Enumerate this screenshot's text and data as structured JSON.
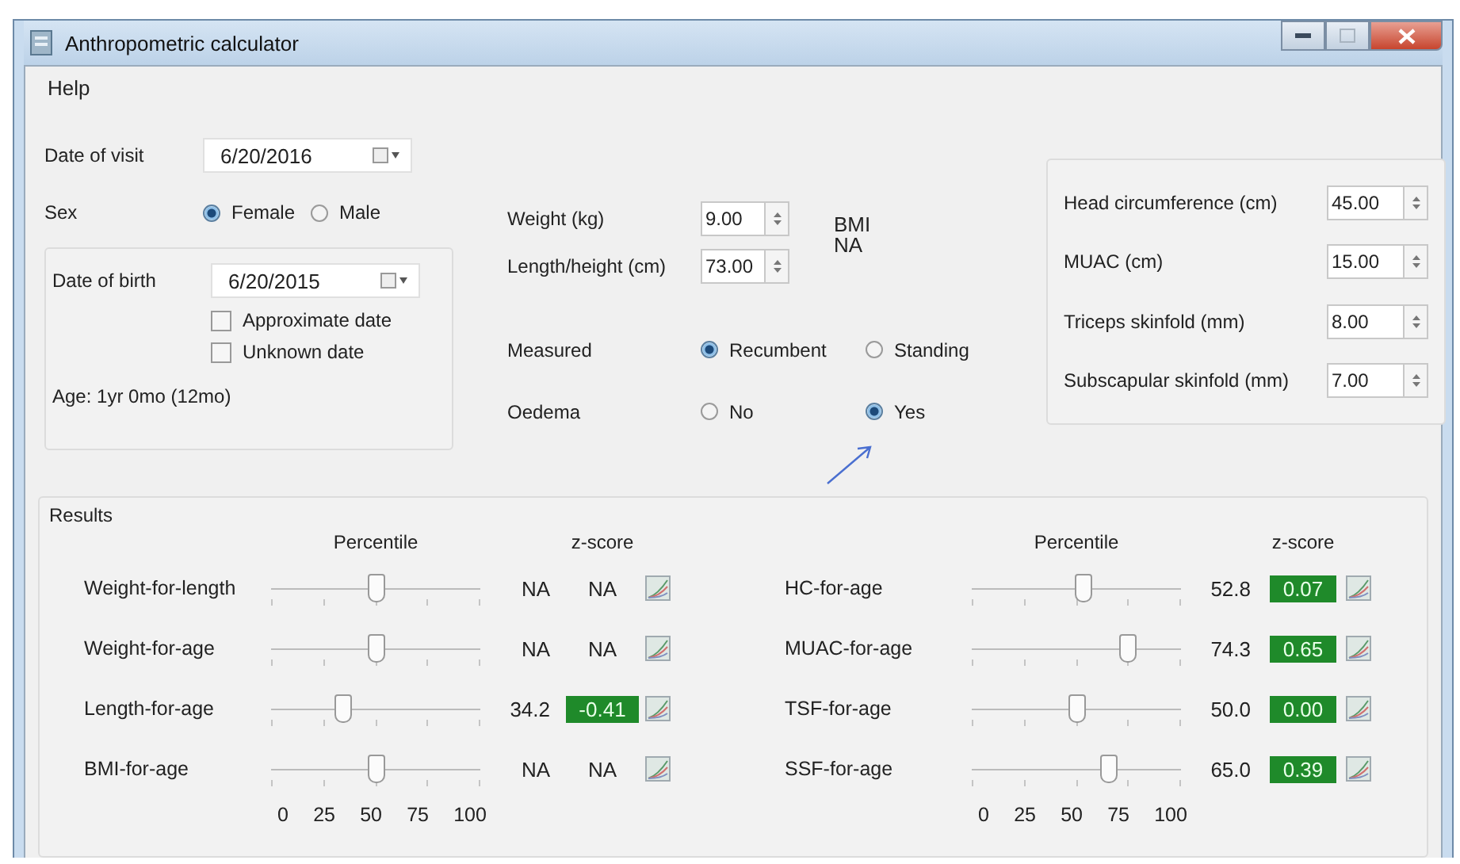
{
  "window": {
    "title": "Anthropometric calculator"
  },
  "menu": [
    {
      "label": "Help"
    }
  ],
  "visit": {
    "label": "Date of visit",
    "value": "6/20/2016"
  },
  "sex": {
    "label": "Sex",
    "options": [
      {
        "label": "Female",
        "selected": true
      },
      {
        "label": "Male",
        "selected": false
      }
    ]
  },
  "birth": {
    "label": "Date of birth",
    "value": "6/20/2015",
    "checkboxes": [
      {
        "label": "Approximate date",
        "checked": false
      },
      {
        "label": "Unknown date",
        "checked": false
      }
    ],
    "age": "Age: 1yr 0mo (12mo)"
  },
  "measures": [
    {
      "label": "Weight (kg)",
      "value": "9.00"
    },
    {
      "label": "Length/height (cm)",
      "value": "73.00"
    }
  ],
  "bmi": {
    "label": "BMI",
    "value": "NA"
  },
  "radio_groups": [
    {
      "label": "Measured",
      "options": [
        {
          "label": "Recumbent",
          "selected": true
        },
        {
          "label": "Standing",
          "selected": false
        }
      ]
    },
    {
      "label": "Oedema",
      "options": [
        {
          "label": "No",
          "selected": false
        },
        {
          "label": "Yes",
          "selected": true
        }
      ]
    }
  ],
  "extra_measures": [
    {
      "label": "Head circumference (cm)",
      "value": "45.00"
    },
    {
      "label": "MUAC (cm)",
      "value": "15.00"
    },
    {
      "label": "Triceps skinfold (mm)",
      "value": "8.00"
    },
    {
      "label": "Subscapular skinfold (mm)",
      "value": "7.00"
    }
  ],
  "results": {
    "title": "Results",
    "panels": [
      {
        "percentile_header": "Percentile",
        "zscore_header": "z-score",
        "scale": [
          "0",
          "25",
          "50",
          "75",
          "100"
        ],
        "rows": [
          {
            "name": "Weight-for-length",
            "level": 0.5,
            "percentile": "NA",
            "zscore": "NA",
            "highlighted": false
          },
          {
            "name": "Weight-for-age",
            "level": 0.5,
            "percentile": "NA",
            "zscore": "NA",
            "highlighted": false
          },
          {
            "name": "Length-for-age",
            "level": 0.342,
            "percentile": "34.2",
            "zscore": "-0.41",
            "highlighted": true
          },
          {
            "name": "BMI-for-age",
            "level": 0.5,
            "percentile": "NA",
            "zscore": "NA",
            "highlighted": false
          }
        ]
      },
      {
        "percentile_header": "Percentile",
        "zscore_header": "z-score",
        "scale": [
          "0",
          "25",
          "50",
          "75",
          "100"
        ],
        "rows": [
          {
            "name": "HC-for-age",
            "level": 0.528,
            "percentile": "52.8",
            "zscore": "0.07",
            "highlighted": true
          },
          {
            "name": "MUAC-for-age",
            "level": 0.743,
            "percentile": "74.3",
            "zscore": "0.65",
            "highlighted": true
          },
          {
            "name": "TSF-for-age",
            "level": 0.5,
            "percentile": "50.0",
            "zscore": "0.00",
            "highlighted": true
          },
          {
            "name": "SSF-for-age",
            "level": 0.65,
            "percentile": "65.0",
            "zscore": "0.39",
            "highlighted": true
          }
        ]
      }
    ]
  }
}
